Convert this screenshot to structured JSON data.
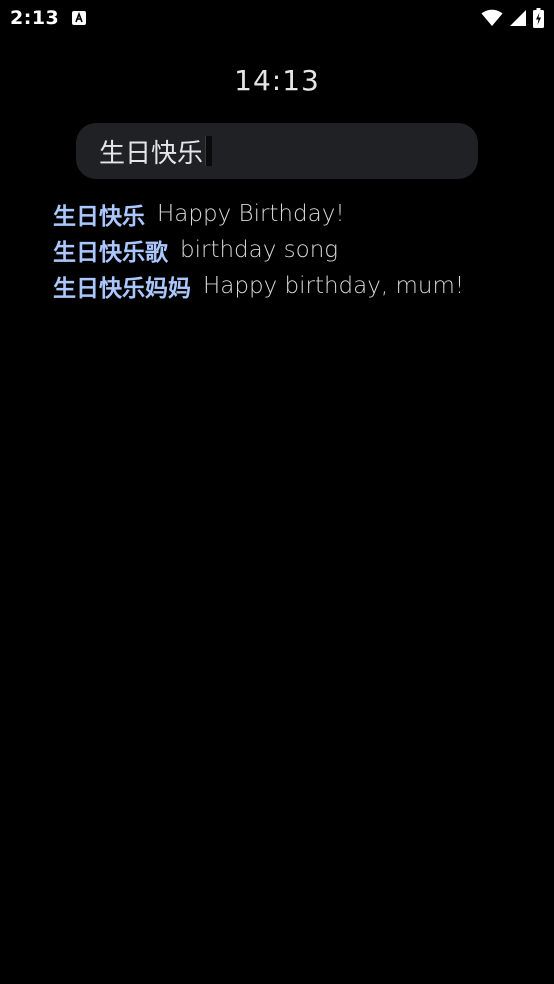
{
  "status_bar": {
    "time": "2:13",
    "icons": [
      "notification-a-icon",
      "wifi-icon",
      "signal-icon",
      "battery-charging-icon"
    ]
  },
  "clock": {
    "time": "14:13"
  },
  "search": {
    "value": "生日快乐"
  },
  "suggestions": [
    {
      "term": "生日快乐",
      "translation": "Happy Birthday!"
    },
    {
      "term": "生日快乐歌",
      "translation": "birthday song"
    },
    {
      "term": "生日快乐妈妈",
      "translation": "Happy birthday, mum!"
    }
  ],
  "colors": {
    "background": "#000000",
    "search_field": "#1f2125",
    "term": "#aac7ff",
    "translation": "#d8d8da"
  }
}
